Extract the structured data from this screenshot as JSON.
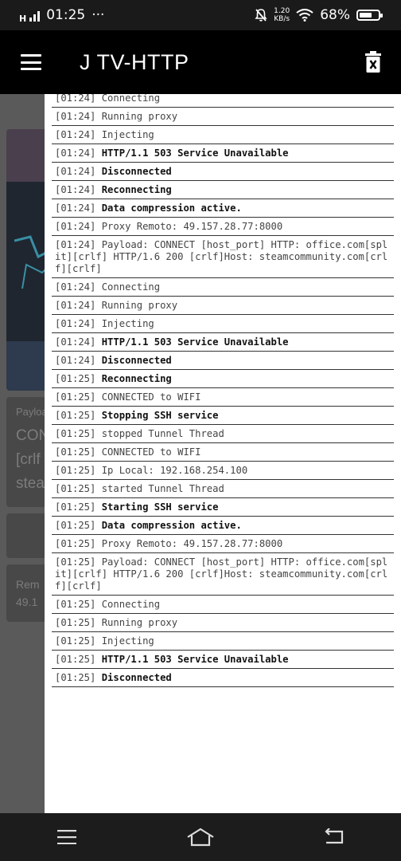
{
  "status": {
    "network": "H",
    "time": "01:25",
    "dots": "···",
    "speed_value": "1.20",
    "speed_unit": "KB/s",
    "battery": "68%",
    "battery_level": 0.68
  },
  "appbar": {
    "title": "J TV-HTTP"
  },
  "background": {
    "payload_label": "Payloa",
    "payload_line1": "CON",
    "payload_line2": "[crlf",
    "payload_line3": "stea",
    "remote_label": "Rem",
    "remote_value": "49.1"
  },
  "log": [
    {
      "ts": "[01:24]",
      "msg": "Connecting",
      "bold": false
    },
    {
      "ts": "[01:24]",
      "msg": "Running proxy",
      "bold": false
    },
    {
      "ts": "[01:24]",
      "msg": "Injecting",
      "bold": false
    },
    {
      "ts": "[01:24]",
      "msg": "HTTP/1.1 503 Service Unavailable",
      "bold": true
    },
    {
      "ts": "[01:24]",
      "msg": "Disconnected",
      "bold": true
    },
    {
      "ts": "[01:24]",
      "msg": "Reconnecting",
      "bold": true
    },
    {
      "ts": "[01:24]",
      "msg": "Data compression active.",
      "bold": true
    },
    {
      "ts": "[01:24]",
      "msg": "Proxy Remoto: 49.157.28.77:8000",
      "bold": false
    },
    {
      "ts": "[01:24]",
      "msg": "Payload: CONNECT [host_port] HTTP: office.com[split][crlf] HTTP/1.6 200 [crlf]Host: steamcommunity.com[crlf][crlf]",
      "bold": false
    },
    {
      "ts": "[01:24]",
      "msg": "Connecting",
      "bold": false
    },
    {
      "ts": "[01:24]",
      "msg": "Running proxy",
      "bold": false
    },
    {
      "ts": "[01:24]",
      "msg": "Injecting",
      "bold": false
    },
    {
      "ts": "[01:24]",
      "msg": "HTTP/1.1 503 Service Unavailable",
      "bold": true
    },
    {
      "ts": "[01:24]",
      "msg": "Disconnected",
      "bold": true
    },
    {
      "ts": "[01:25]",
      "msg": "Reconnecting",
      "bold": true
    },
    {
      "ts": "[01:25]",
      "msg": "CONNECTED to WIFI",
      "bold": false
    },
    {
      "ts": "[01:25]",
      "msg": "Stopping SSH service",
      "bold": true
    },
    {
      "ts": "[01:25]",
      "msg": "stopped Tunnel Thread",
      "bold": false
    },
    {
      "ts": "[01:25]",
      "msg": "CONNECTED to WIFI",
      "bold": false
    },
    {
      "ts": "[01:25]",
      "msg": "Ip Local: 192.168.254.100",
      "bold": false
    },
    {
      "ts": "[01:25]",
      "msg": "started Tunnel Thread",
      "bold": false
    },
    {
      "ts": "[01:25]",
      "msg": "Starting SSH service",
      "bold": true
    },
    {
      "ts": "[01:25]",
      "msg": "Data compression active.",
      "bold": true
    },
    {
      "ts": "[01:25]",
      "msg": "Proxy Remoto: 49.157.28.77:8000",
      "bold": false
    },
    {
      "ts": "[01:25]",
      "msg": "Payload: CONNECT [host_port] HTTP: office.com[split][crlf] HTTP/1.6 200 [crlf]Host: steamcommunity.com[crlf][crlf]",
      "bold": false
    },
    {
      "ts": "[01:25]",
      "msg": "Connecting",
      "bold": false
    },
    {
      "ts": "[01:25]",
      "msg": "Running proxy",
      "bold": false
    },
    {
      "ts": "[01:25]",
      "msg": "Injecting",
      "bold": false
    },
    {
      "ts": "[01:25]",
      "msg": "HTTP/1.1 503 Service Unavailable",
      "bold": true
    },
    {
      "ts": "[01:25]",
      "msg": "Disconnected",
      "bold": true
    }
  ],
  "icons": {
    "menu": "menu-icon",
    "trash": "delete-icon",
    "nav_menu": "recent-apps-icon",
    "nav_home": "home-icon",
    "nav_back": "back-icon"
  }
}
